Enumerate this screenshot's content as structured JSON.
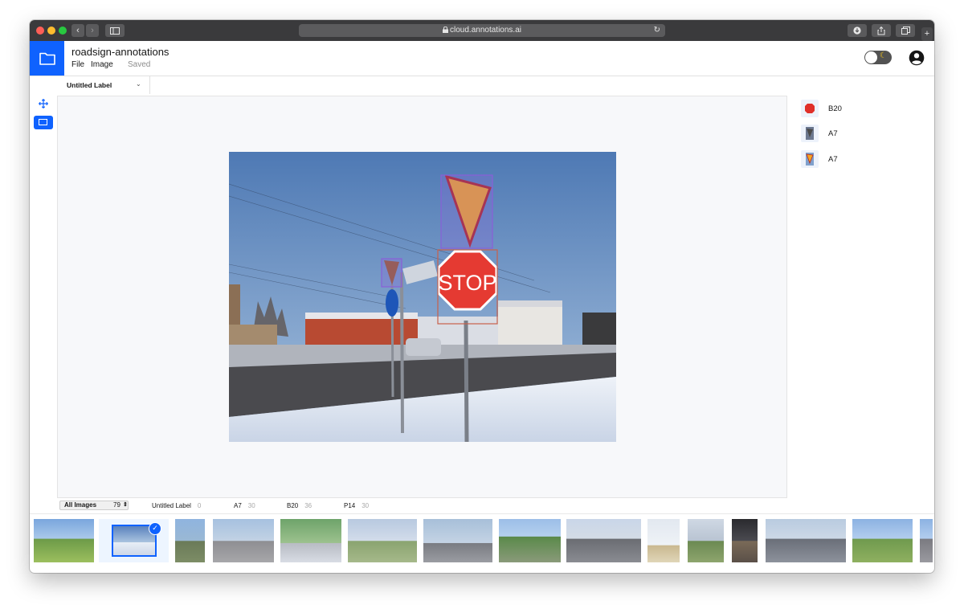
{
  "browser": {
    "url": "cloud.annotations.ai",
    "lock_icon": "lock-icon",
    "nav_back": "‹",
    "nav_forward": "›"
  },
  "app": {
    "project_title": "roadsign-annotations",
    "menu": {
      "file": "File",
      "image": "Image"
    },
    "save_status": "Saved",
    "accent_color": "#0f62fe"
  },
  "toolbar": {
    "label_dropdown": "Untitled Label",
    "tools": [
      "move-icon",
      "bounding-box-icon"
    ]
  },
  "annotations": [
    {
      "label": "B20",
      "icon": "stop-sign-thumb"
    },
    {
      "label": "A7",
      "icon": "yield-sign-thumb"
    },
    {
      "label": "A7",
      "icon": "yield-sign-thumb"
    }
  ],
  "filters": {
    "view": {
      "label": "All Images",
      "count": "79"
    },
    "labels": [
      {
        "name": "Untitled Label",
        "count": "0"
      },
      {
        "name": "A7",
        "count": "30"
      },
      {
        "name": "B20",
        "count": "36"
      },
      {
        "name": "P14",
        "count": "30"
      }
    ]
  }
}
